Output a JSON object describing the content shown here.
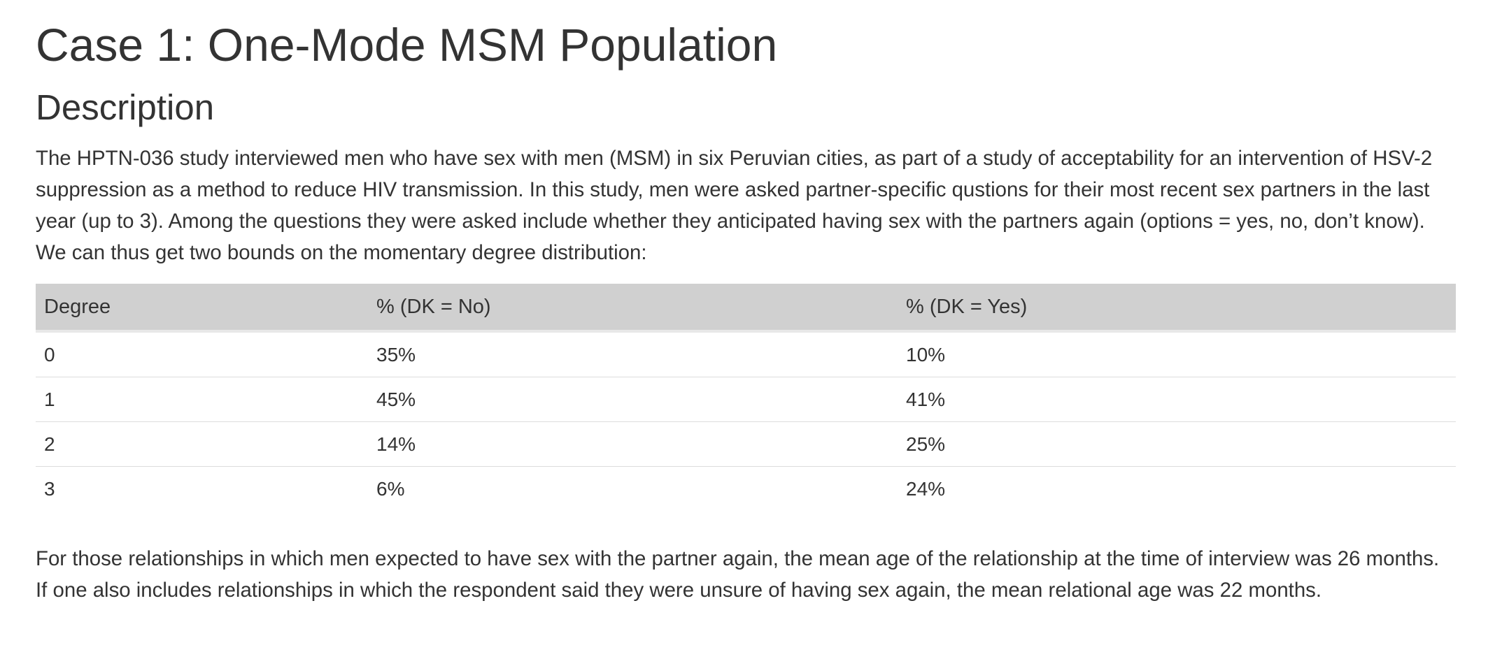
{
  "heading": "Case 1: One-Mode MSM Population",
  "subheading": "Description",
  "intro_paragraph": "The HPTN-036 study interviewed men who have sex with men (MSM) in six Peruvian cities, as part of a study of acceptability for an intervention of HSV-2 suppression as a method to reduce HIV transmission. In this study, men were asked partner-specific qustions for their most recent sex partners in the last year (up to 3). Among the questions they were asked include whether they anticipated having sex with the partners again (options = yes, no, don’t know). We can thus get two bounds on the momentary degree distribution:",
  "table": {
    "headers": [
      "Degree",
      "% (DK = No)",
      "% (DK = Yes)"
    ],
    "rows": [
      [
        "0",
        "35%",
        "10%"
      ],
      [
        "1",
        "45%",
        "41%"
      ],
      [
        "2",
        "14%",
        "25%"
      ],
      [
        "3",
        "6%",
        "24%"
      ]
    ]
  },
  "outro_paragraph": "For those relationships in which men expected to have sex with the partner again, the mean age of the relationship at the time of interview was 26 months. If one also includes relationships in which the respondent said they were unsure of having sex again, the mean relational age was 22 months."
}
